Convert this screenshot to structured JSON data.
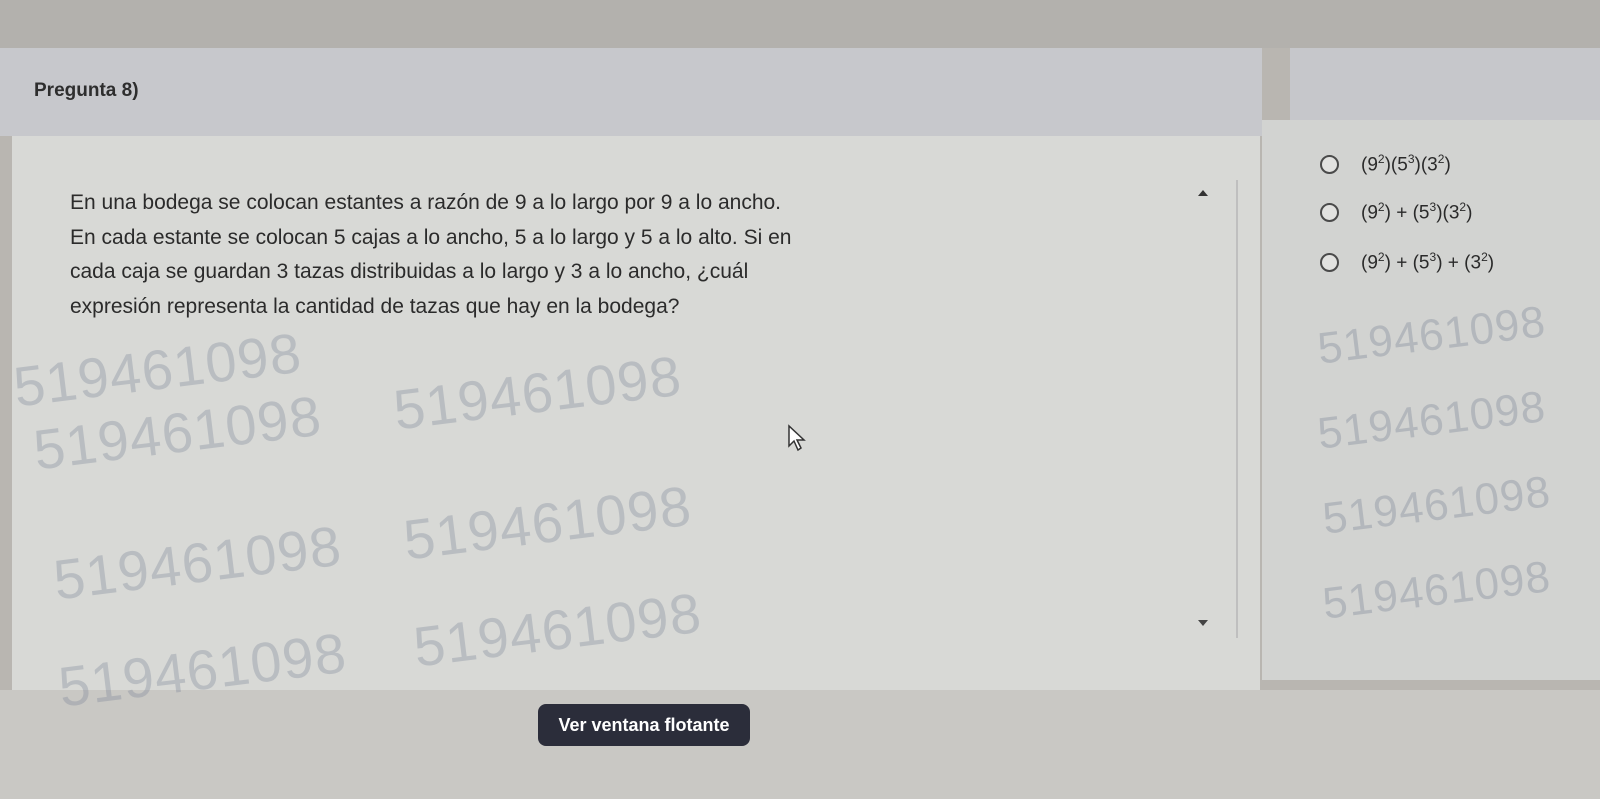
{
  "question": {
    "title": "Pregunta 8)",
    "lines": [
      "En una bodega se colocan estantes a razón de 9 a lo largo por 9 a lo ancho.",
      "En cada estante se colocan 5 cajas a lo ancho, 5 a lo largo y 5 a lo alto. Si en",
      "cada caja se guardan 3 tazas distribuidas a lo largo y 3 a lo ancho, ¿cuál",
      "expresión representa la cantidad de tazas que hay en la bodega?"
    ]
  },
  "options": [
    {
      "base1": "9",
      "exp1": "2",
      "op1": "",
      "base2": "5",
      "exp2": "3",
      "op2": "",
      "base3": "3",
      "exp3": "2"
    },
    {
      "base1": "9",
      "exp1": "2",
      "op1": "+",
      "base2": "5",
      "exp2": "3",
      "op2": "",
      "base3": "3",
      "exp3": "2"
    },
    {
      "base1": "9",
      "exp1": "2",
      "op1": "+",
      "base2": "5",
      "exp2": "3",
      "op2": "+",
      "base3": "3",
      "exp3": "2"
    }
  ],
  "float_button_label": "Ver ventana flotante",
  "watermark_text": "519461098"
}
